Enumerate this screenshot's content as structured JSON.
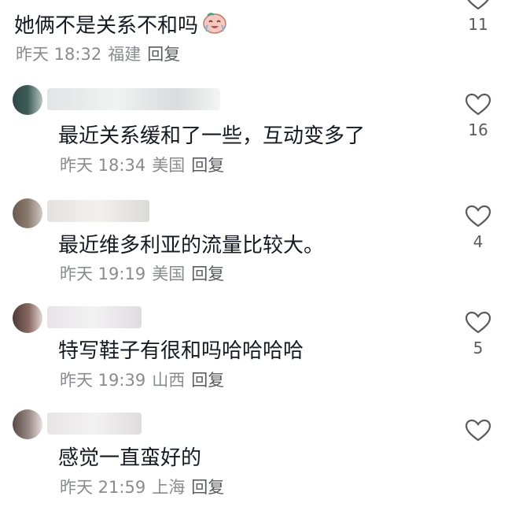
{
  "comments": [
    {
      "text": "她俩不是关系不和吗",
      "emoji": "crying-laughing-face",
      "time": "昨天 18:32",
      "location": "福建",
      "reply": "回复",
      "likes": "11"
    },
    {
      "text": "最近关系缓和了一些，互动变多了",
      "time": "昨天 18:34",
      "location": "美国",
      "reply": "回复",
      "likes": "16"
    },
    {
      "text": "最近维多利亚的流量比较大。",
      "time": "昨天 19:19",
      "location": "美国",
      "reply": "回复",
      "likes": "4"
    },
    {
      "text": "特写鞋子有很和吗哈哈哈哈",
      "time": "昨天 19:39",
      "location": "山西",
      "reply": "回复",
      "likes": "5"
    },
    {
      "text": "感觉一直蛮好的",
      "time": "昨天 21:59",
      "location": "上海",
      "reply": "回复",
      "likes": ""
    }
  ],
  "icons": {
    "like": "heart-outline-icon",
    "emoji": "crying-laughing-face"
  },
  "colors": {
    "text": "#161823",
    "meta": "#8a8b91",
    "icon": "#5a5b61"
  }
}
